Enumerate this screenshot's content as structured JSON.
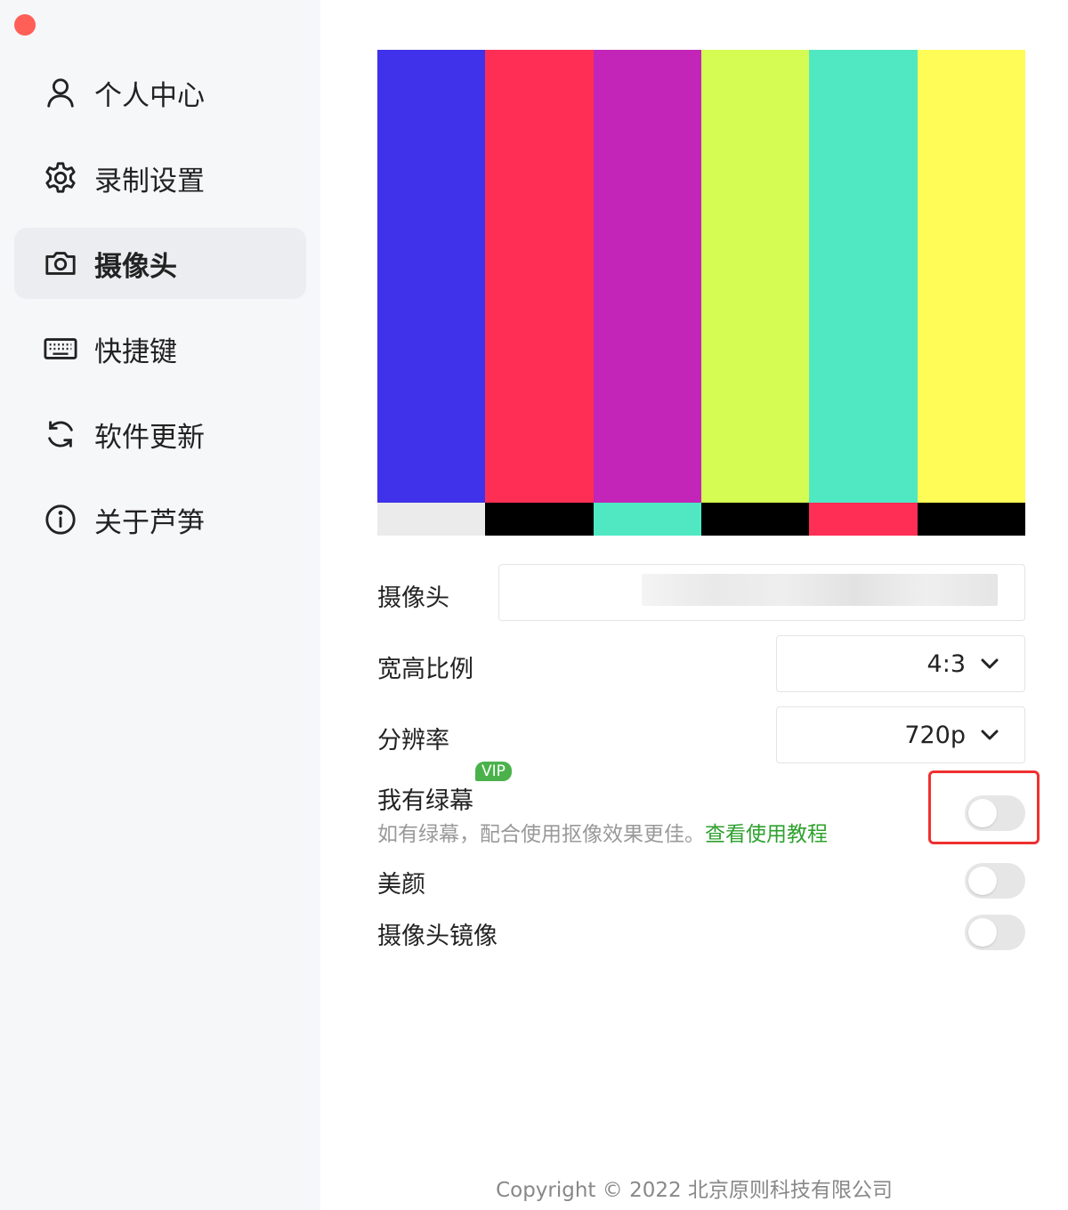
{
  "sidebar": {
    "items": [
      {
        "label": "个人中心",
        "icon": "user-icon"
      },
      {
        "label": "录制设置",
        "icon": "gear-icon"
      },
      {
        "label": "摄像头",
        "icon": "camera-icon"
      },
      {
        "label": "快捷键",
        "icon": "keyboard-icon"
      },
      {
        "label": "软件更新",
        "icon": "refresh-icon"
      },
      {
        "label": "关于芦笋",
        "icon": "info-icon"
      }
    ],
    "active_index": 2
  },
  "preview": {
    "top_colors": [
      "#4032ea",
      "#ff2e55",
      "#c225b7",
      "#d4fc52",
      "#50e8c3",
      "#fffb57"
    ],
    "bottom_colors": [
      "#ebebeb",
      "#000000",
      "#50e8c3",
      "#000000",
      "#ff2e55",
      "#000000"
    ]
  },
  "settings": {
    "camera_label": "摄像头",
    "aspect_label": "宽高比例",
    "aspect_value": "4:3",
    "resolution_label": "分辨率",
    "resolution_value": "720p",
    "greenscreen_label": "我有绿幕",
    "vip_badge": "VIP",
    "greenscreen_desc": "如有绿幕，配合使用抠像效果更佳。",
    "greenscreen_link": "查看使用教程",
    "beauty_label": "美颜",
    "mirror_label": "摄像头镜像",
    "greenscreen_on": false,
    "beauty_on": false,
    "mirror_on": false
  },
  "footer": "Copyright © 2022 北京原则科技有限公司"
}
